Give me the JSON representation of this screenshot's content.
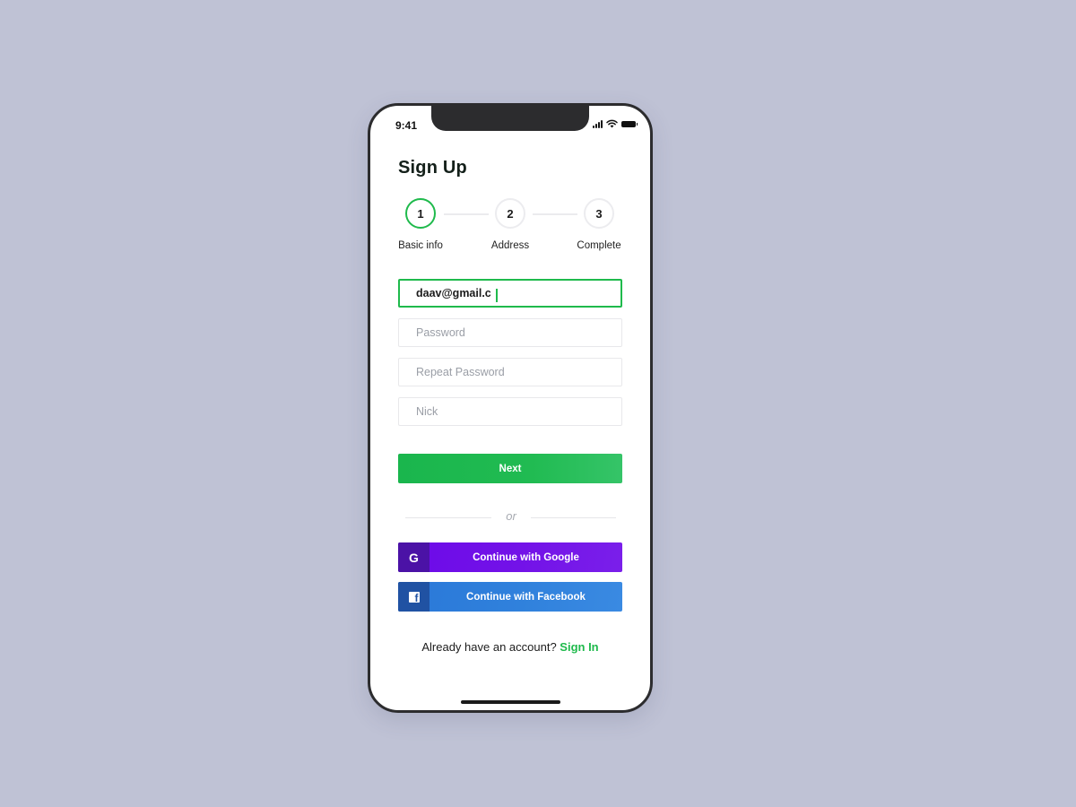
{
  "status_bar": {
    "time": "9:41",
    "icons": [
      "signal-icon",
      "wifi-icon",
      "battery-icon"
    ]
  },
  "title": "Sign Up",
  "steps": [
    {
      "number": "1",
      "label": "Basic info",
      "active": true
    },
    {
      "number": "2",
      "label": "Address",
      "active": false
    },
    {
      "number": "3",
      "label": "Complete",
      "active": false
    }
  ],
  "form": {
    "email": {
      "value": "daav@gmail.c",
      "placeholder": ""
    },
    "password": {
      "value": "",
      "placeholder": "Password"
    },
    "repeat_password": {
      "value": "",
      "placeholder": "Repeat Password"
    },
    "nick": {
      "value": "",
      "placeholder": "Nick"
    }
  },
  "next_button": "Next",
  "divider_text": "or",
  "social": {
    "google": {
      "label": "Continue with Google",
      "icon": "google-icon",
      "glyph": "G"
    },
    "facebook": {
      "label": "Continue with Facebook",
      "icon": "facebook-icon",
      "glyph": "f"
    }
  },
  "signin": {
    "prompt": "Already have an account?",
    "link": "Sign In"
  },
  "colors": {
    "background": "#bfc2d5",
    "accent_green": "#1fba4c",
    "google_purple": "#6c0ae8",
    "facebook_blue": "#2a78d8"
  }
}
